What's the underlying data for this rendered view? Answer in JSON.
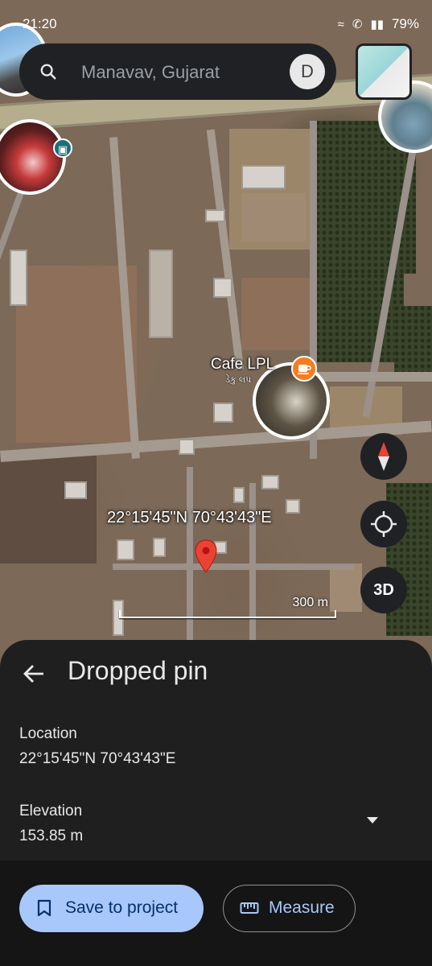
{
  "status_bar": {
    "time": "21:20",
    "battery": "79%"
  },
  "search": {
    "placeholder": "Manavav, Gujarat",
    "avatar_initial": "D"
  },
  "map": {
    "poi_name": "Cafe LPL",
    "poi_subtitle": "ડેકુ લપ",
    "coordinates_label": "22°15'45\"N 70°43'43\"E",
    "scale_label": "300 m",
    "button_3d": "3D",
    "poi_badge_color": "#f57c1f",
    "pin_color": "#ea4335"
  },
  "sheet": {
    "title": "Dropped pin",
    "location_label": "Location",
    "location_value": "22°15'45\"N 70°43'43\"E",
    "elevation_label": "Elevation",
    "elevation_value": "153.85 m",
    "save_button": "Save to project",
    "measure_button": "Measure"
  },
  "icons": [
    "search-icon",
    "layers-icon",
    "bus-icon",
    "coffee-icon",
    "compass-icon",
    "my-location-icon",
    "back-arrow-icon",
    "bookmark-icon",
    "ruler-icon",
    "chevron-down-icon",
    "map-pin-icon"
  ]
}
